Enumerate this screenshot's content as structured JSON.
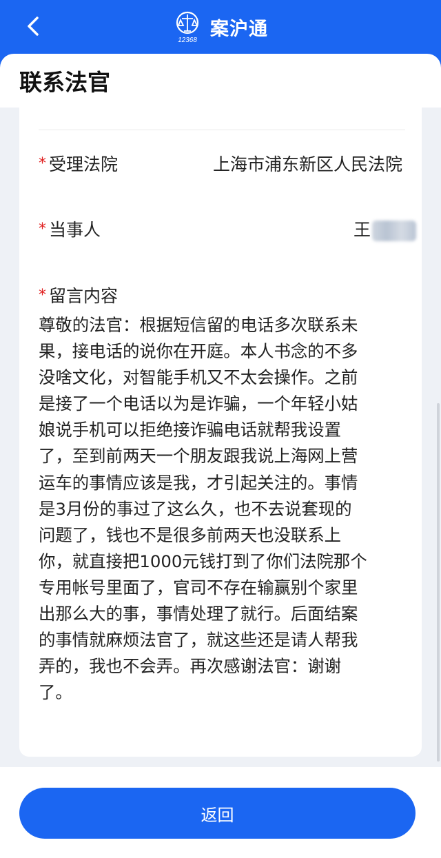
{
  "app": {
    "title": "案沪通",
    "logo_number": "12368"
  },
  "page": {
    "title": "联系法官"
  },
  "form": {
    "court": {
      "required_mark": "*",
      "label": "受理法院",
      "value": "上海市浦东新区人民法院"
    },
    "party": {
      "required_mark": "*",
      "label": "当事人",
      "value": "王"
    },
    "message": {
      "required_mark": "*",
      "label": "留言内容",
      "lines": [
        "尊敬的法官：根据短信留的电话多次联系未",
        "果，接电话的说你在开庭。本人书念的不多",
        "没啥文化，对智能手机又不太会操作。之前",
        "是接了一个电话以为是诈骗，一个年轻小姑",
        "娘说手机可以拒绝接诈骗电话就帮我设置",
        "了，至到前两天一个朋友跟我说上海网上营",
        "运车的事情应该是我，才引起关注的。事情",
        "是3月份的事过了这么久，也不去说套现的",
        "问题了，钱也不是很多前两天也没联系上",
        "你，就直接把1000元钱打到了你们法院那个",
        "专用帐号里面了，官司不存在输赢别个家里",
        "出那么大的事，事情处理了就行。后面结案",
        "的事情就麻烦法官了，就这些还是请人帮我",
        "弄的，我也不会弄。再次感谢法官：谢谢",
        "了。"
      ]
    }
  },
  "footer": {
    "return_label": "返回"
  },
  "colors": {
    "brand": "#1b66f2",
    "required": "#e02020"
  },
  "icons": {
    "back": "chevron-left-icon",
    "logo": "court-emblem-icon"
  }
}
